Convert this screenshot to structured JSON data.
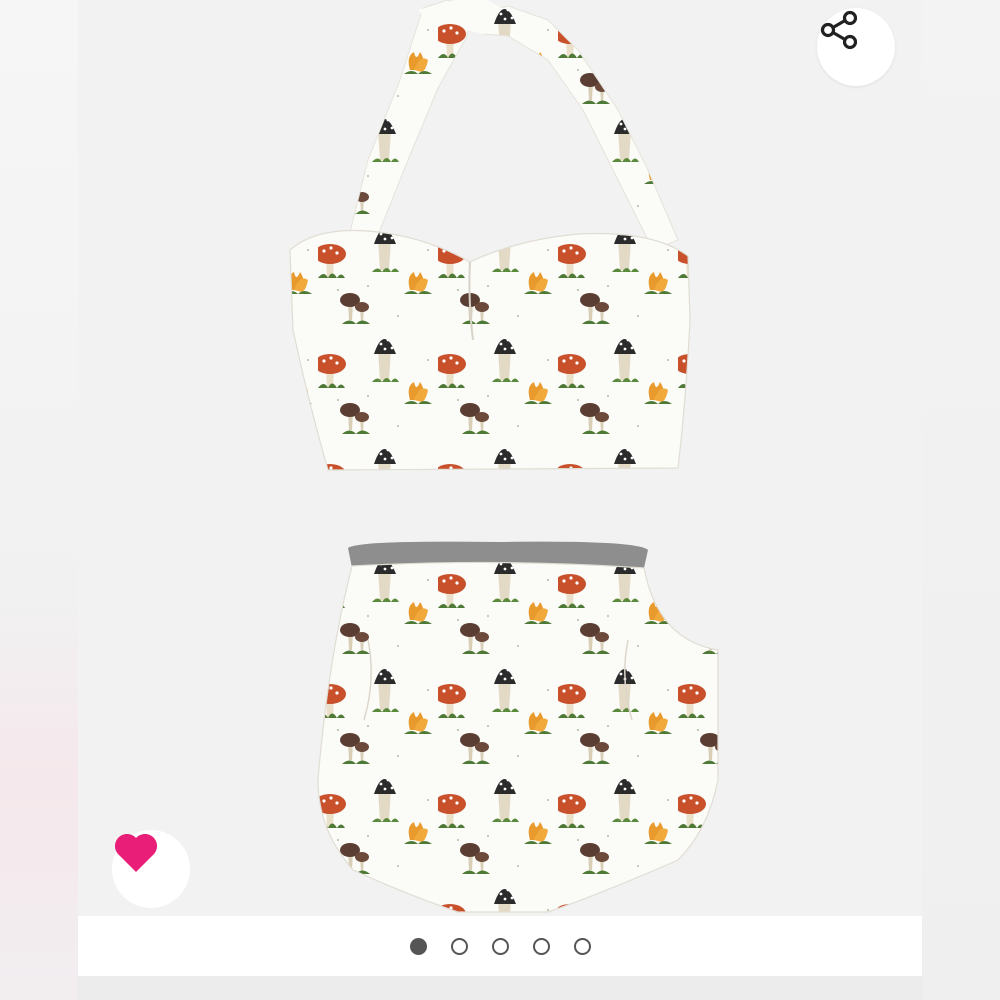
{
  "product_gallery": {
    "image_alt": "",
    "share": {
      "icon": "share-icon"
    },
    "like": {
      "icon": "heart-icon",
      "color": "#e91e78"
    },
    "pagination": {
      "total": 5,
      "active_index": 0
    }
  },
  "colors": {
    "accent_heart": "#e91e78",
    "dot": "#555555",
    "mushroom_red": "#c8502a",
    "mushroom_orange": "#e89a2c",
    "mushroom_dark": "#2b2b2b",
    "grass": "#4f7a35"
  }
}
